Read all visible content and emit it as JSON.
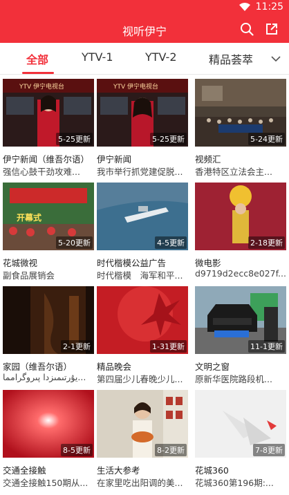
{
  "status_bar": {
    "time": "11:25"
  },
  "app_bar": {
    "title": "视听伊宁"
  },
  "tabs": [
    {
      "label": "全部",
      "active": true
    },
    {
      "label": "YTV-1",
      "active": false
    },
    {
      "label": "YTV-2",
      "active": false
    },
    {
      "label": "精品荟萃",
      "active": false
    }
  ],
  "videos": [
    {
      "category": "伊宁新闻（维吾尔语）",
      "title": "强信心鼓干劲攻难...",
      "badge": "5-25更新",
      "thumb_text": "YTV 伊宁电视台"
    },
    {
      "category": "伊宁新闻",
      "title": "我市举行抓党建促脱...",
      "badge": "5-25更新",
      "thumb_text": "YTV 伊宁电视台"
    },
    {
      "category": "视频汇",
      "title": "香港特区立法会主...",
      "badge": "5-24更新",
      "thumb_text": ""
    },
    {
      "category": "花城微视",
      "title": "副食品展销会",
      "badge": "5-20更新",
      "thumb_text": "开幕式"
    },
    {
      "category": "时代楷模公益广告",
      "title": "时代楷模　海军和平...",
      "badge": "4-5更新",
      "thumb_text": ""
    },
    {
      "category": "微电影",
      "title": "d9719d2ecc8e027f...",
      "badge": "2-18更新",
      "thumb_text": ""
    },
    {
      "category": "家园（维吾尔语）",
      "title": "يۇرتىمىزدا  پىروگرامما...",
      "badge": "2-1更新",
      "thumb_text": ""
    },
    {
      "category": "精品晚会",
      "title": "第四届少儿春晚少儿...",
      "badge": "1-31更新",
      "thumb_text": ""
    },
    {
      "category": "文明之窗",
      "title": "原新华医院路段机...",
      "badge": "11-1更新",
      "thumb_text": ""
    },
    {
      "category": "交通全接触",
      "title": "交通全接触150期从...",
      "badge": "8-5更新",
      "thumb_text": ""
    },
    {
      "category": "生活大参考",
      "title": "在家里吃出阳调的美...",
      "badge": "8-2更新",
      "thumb_text": ""
    },
    {
      "category": "花城360",
      "title": "花城360第196期:...",
      "badge": "7-8更新",
      "thumb_text": ""
    }
  ],
  "colors": {
    "accent": "#f2303a"
  },
  "icons": {
    "search": "search-icon",
    "share": "share-icon",
    "more": "chevron-down-icon",
    "wifi": "wifi-icon"
  }
}
